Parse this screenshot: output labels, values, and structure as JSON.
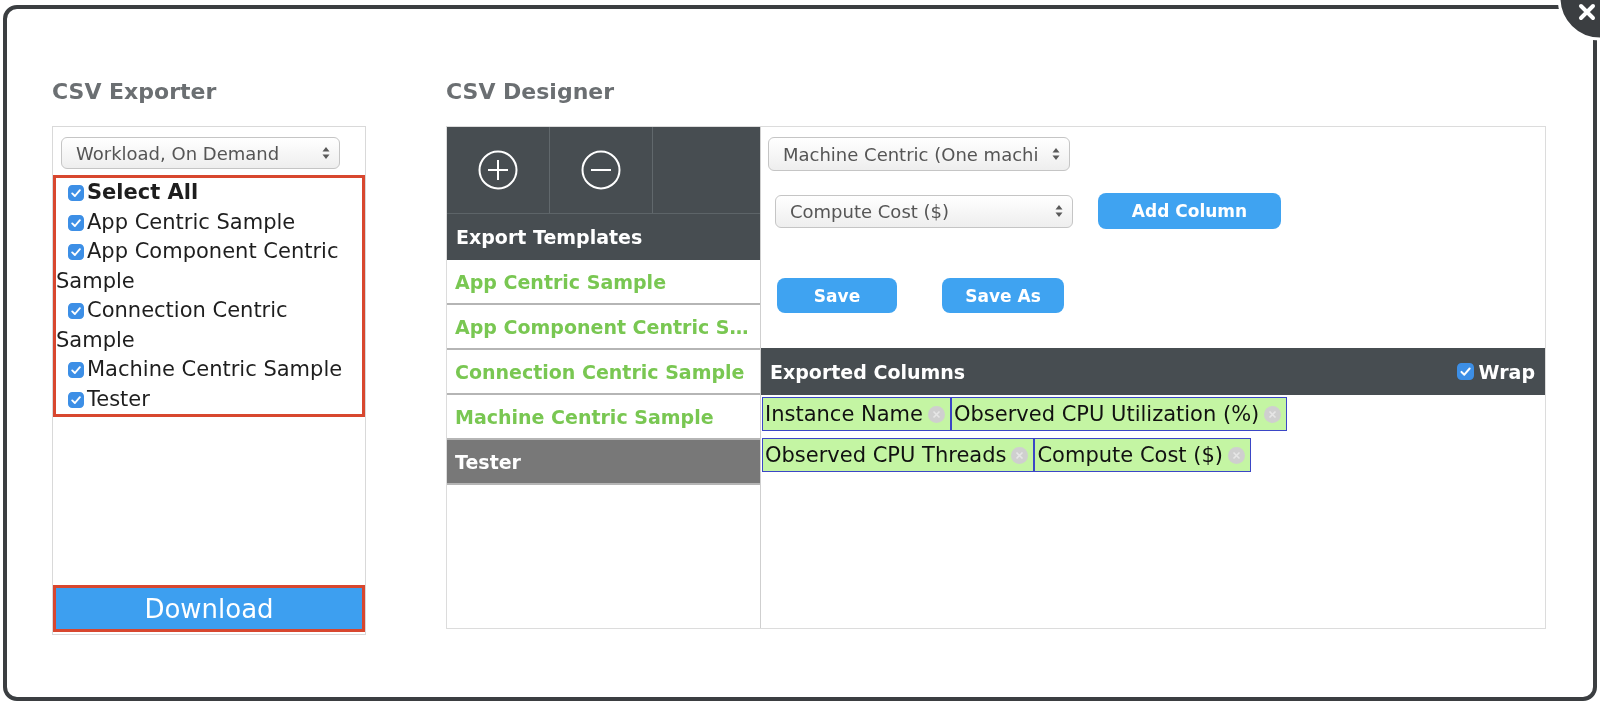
{
  "exporter": {
    "title": "CSV Exporter",
    "dataset": {
      "value": "Workload, On Demand"
    },
    "options": [
      {
        "kind": "select_all",
        "label": "Select All",
        "checked": true
      },
      {
        "kind": "template",
        "label": "App Centric Sample",
        "checked": true
      },
      {
        "kind": "template",
        "label": "App Component Centric Sample",
        "checked": true
      },
      {
        "kind": "template",
        "label": "Connection Centric Sample",
        "checked": true
      },
      {
        "kind": "template",
        "label": "Machine Centric Sample",
        "checked": true
      },
      {
        "kind": "template",
        "label": "Tester",
        "checked": true
      }
    ],
    "download": "Download"
  },
  "designer": {
    "title": "CSV Designer",
    "templates_header": "Export Templates",
    "templates": [
      {
        "label": "App Centric Sample",
        "selected": false
      },
      {
        "label": "App Component Centric S…",
        "selected": false
      },
      {
        "label": "Connection Centric Sample",
        "selected": false
      },
      {
        "label": "Machine Centric Sample",
        "selected": false
      },
      {
        "label": "Tester",
        "selected": true
      }
    ],
    "template_type": {
      "value": "Machine Centric (One machi"
    },
    "column_picker": {
      "value": "Compute Cost ($)"
    },
    "buttons": {
      "add_column": "Add Column",
      "save": "Save",
      "save_as": "Save As"
    },
    "exported_columns": {
      "title": "Exported Columns",
      "wrap": {
        "label": "Wrap",
        "checked": true
      },
      "columns": [
        "Instance Name",
        "Observed CPU Utilization (%)",
        "Observed CPU Threads",
        "Compute Cost ($)"
      ]
    }
  }
}
